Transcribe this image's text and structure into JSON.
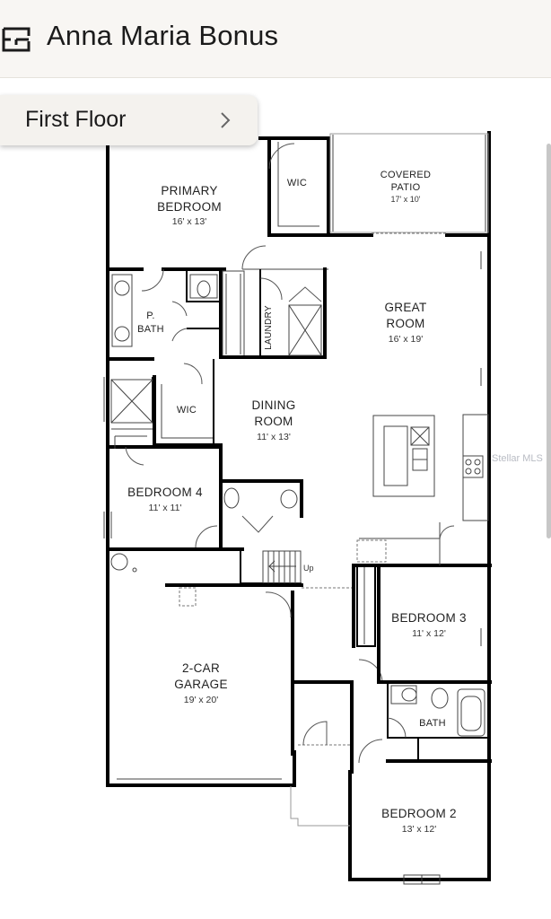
{
  "header": {
    "title": "Anna Maria Bonus",
    "icon": "floorplan-icon"
  },
  "floor_selector": {
    "label": "First Floor",
    "icon": "chevron-right-icon"
  },
  "plan": {
    "rooms": {
      "primary_bedroom": {
        "line1": "PRIMARY",
        "line2": "BEDROOM",
        "dim": "16' x 13'"
      },
      "wic_top": {
        "name": "WIC"
      },
      "covered_patio": {
        "line1": "COVERED",
        "line2": "PATIO",
        "dim": "17' x 10'"
      },
      "great_room": {
        "line1": "GREAT",
        "line2": "ROOM",
        "dim": "16' x 19'"
      },
      "p_bath": {
        "line1": "P.",
        "line2": "BATH"
      },
      "laundry": {
        "name": "LAUNDRY"
      },
      "wic_mid": {
        "name": "WIC"
      },
      "dining_room": {
        "line1": "DINING",
        "line2": "ROOM",
        "dim": "11' x 13'"
      },
      "bedroom4": {
        "name": "BEDROOM 4",
        "dim": "11' x 11'"
      },
      "stairs": {
        "label": "Up"
      },
      "bedroom3": {
        "name": "BEDROOM 3",
        "dim": "11' x 12'"
      },
      "garage": {
        "line1": "2-CAR",
        "line2": "GARAGE",
        "dim": "19' x 20'"
      },
      "bath": {
        "name": "BATH"
      },
      "bedroom2": {
        "name": "BEDROOM 2",
        "dim": "13' x 12'"
      }
    },
    "watermark": "Stellar MLS"
  }
}
